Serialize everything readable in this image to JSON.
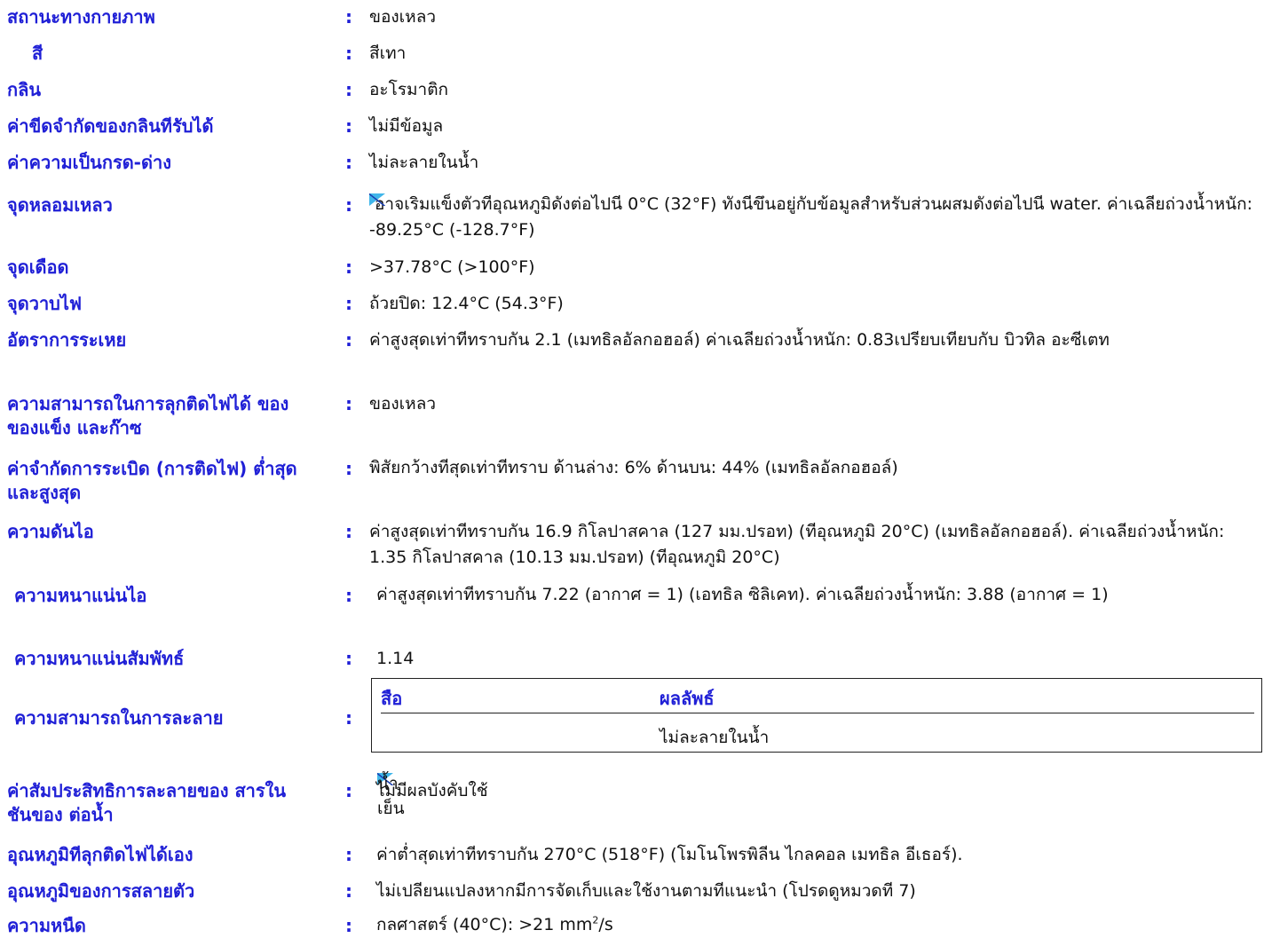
{
  "properties": [
    {
      "label": "สถานะทางกายภาพ",
      "value": "ของเหลว"
    },
    {
      "label": "สี",
      "value": "สีเทา"
    },
    {
      "label": "กลิน",
      "value": "อะโรมาติก"
    },
    {
      "label": "ค่าขีดจำกัดของกลินทีรับได้",
      "value": "ไม่มีข้อมูล"
    },
    {
      "label": "ค่าความเป็นกรด-ด่าง",
      "value": "ไม่ละลายในน้ำ"
    },
    {
      "label": "จุดหลอมเหลว",
      "value": "อาจเริมแข็งตัวทีอุณหภูมิดังต่อไปนี 0°C (32°F) ทังนีขึนอยู่กับข้อมูลสำหรับส่วนผสมดังต่อไปนี water. ค่าเฉลียถ่วงน้ำหนัก: -89.25°C (-128.7°F)"
    },
    {
      "label": "จุดเดือด",
      "value": ">37.78°C (>100°F)"
    },
    {
      "label": "จุดวาบไฟ",
      "value": "ถ้วยปิด: 12.4°C (54.3°F)"
    },
    {
      "label": "อัตราการระเหย",
      "value": "ค่าสูงสุดเท่าทีทราบกัน 2.1 (เมทธิลอัลกอฮอล์)  ค่าเฉลียถ่วงน้ำหนัก: 0.83เปรียบเทียบกับ บิวทิล อะซีเตท"
    },
    {
      "label": "ความสามารถในการลุกติดไฟได้ ของของแข็ง และก๊าซ",
      "value": "ของเหลว"
    },
    {
      "label": "ค่าจำกัดการระเบิด (การติดไฟ) ต่ำสุดและสูงสุด",
      "value": "พิสัยกว้างทีสุดเท่าทีทราบ ด้านล่าง: 6%  ด้านบน: 44% (เมทธิลอัลกอฮอล์)"
    },
    {
      "label": "ความดันไอ",
      "value": "ค่าสูงสุดเท่าทีทราบกัน 16.9 กิโลปาสคาล (127 มม.ปรอท) (ทีอุณหภูมิ 20°C) (เมทธิลอัลกอฮอล์).  ค่าเฉลียถ่วงน้ำหนัก: 1.35 กิโลปาสคาล (10.13 มม.ปรอท) (ทีอุณหภูมิ 20°C)"
    },
    {
      "label": "ความหนาแน่นไอ",
      "value": "ค่าสูงสุดเท่าทีทราบกัน 7.22  (อากาศ = 1)  (เอทธิล ซิลิเคท).  ค่าเฉลียถ่วงน้ำหนัก: 3.88  (อากาศ = 1)"
    },
    {
      "label": "ความหนาแน่นสัมพัทธ์",
      "value": "1.14"
    },
    {
      "label": "ความสามารถในการละลาย",
      "value": ""
    },
    {
      "label": "ค่าสัมประสิทธิการละลายของ สารในชันของ ต่อน้ำ",
      "value": "ไม่มีผลบังคับใช้"
    },
    {
      "label": "อุณหภูมิทีลุกติดไฟได้เอง",
      "value": "ค่าต่ำสุดเท่าทีทราบกัน 270°C (518°F) (โมโนโพรพิลีน ไกลคอล เมทธิล อีเธอร์)."
    },
    {
      "label": "อุณหภูมิของการสลายตัว",
      "value": "ไม่เปลียนแปลงหากมีการจัดเก็บและใช้งานตามทีแนะนำ (โปรดดูหมวดที 7)"
    },
    {
      "label": "ความหนืด",
      "value": "กลศาสตร์ (40°C): >21 mm"
    }
  ],
  "colon": ":",
  "viscosity_superscript": "2",
  "viscosity_unit_tail": "/s",
  "solubility_table": {
    "headers": [
      "สือ",
      "ผลลัพธ์"
    ],
    "rows": [
      [
        "น้ำเย็น",
        "ไม่ละลายในน้ำ"
      ]
    ]
  },
  "colors": {
    "label": "#1f1fd6",
    "text": "#111111",
    "marker": "#40b6ea"
  }
}
